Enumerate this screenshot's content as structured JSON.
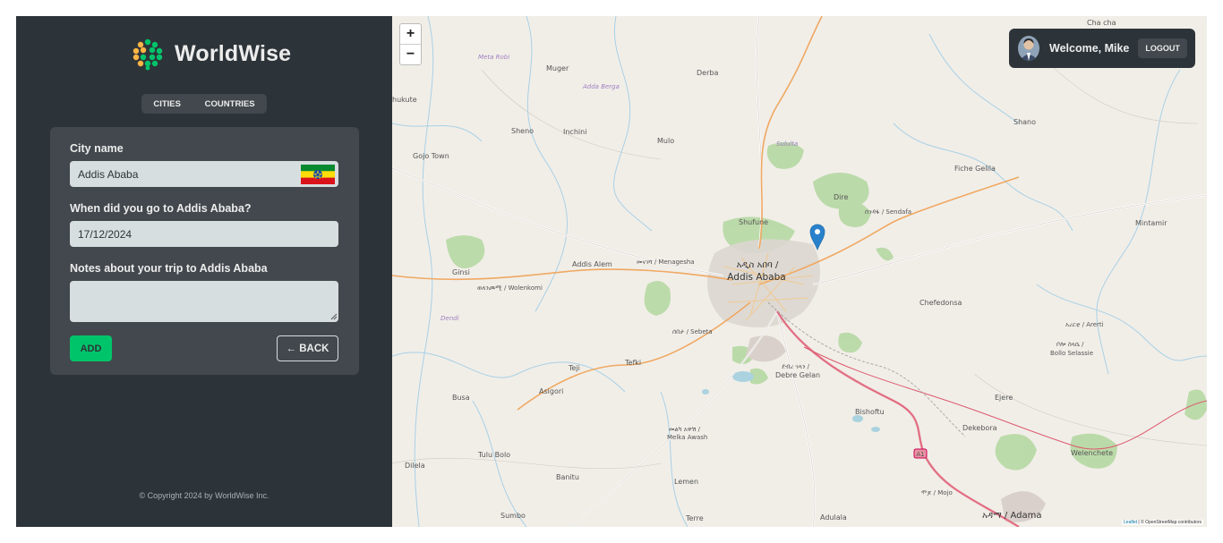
{
  "brand": {
    "name": "WorldWise"
  },
  "nav": {
    "cities": "CITIES",
    "countries": "COUNTRIES"
  },
  "form": {
    "city_label": "City name",
    "city_value": "Addis Ababa",
    "date_label": "When did you go to Addis Ababa?",
    "date_value": "17/12/2024",
    "notes_label": "Notes about your trip to Addis Ababa",
    "notes_value": "",
    "add_label": "ADD",
    "back_label": "← BACK"
  },
  "footer": {
    "copyright": "© Copyright 2024 by WorldWise Inc."
  },
  "user": {
    "welcome": "Welcome, Mike",
    "logout": "LOGOUT"
  },
  "map": {
    "zoom_in": "+",
    "zoom_out": "−",
    "attribution_leaflet": "Leaflet",
    "attribution_rest": " | © OpenStreetMap contributors",
    "places": {
      "muger": "Muger",
      "derba": "Derba",
      "sheno": "Sheno",
      "inchini": "Inchini",
      "mulo": "Mulo",
      "gojo_town": "Gojo Town",
      "hukute": "hukute",
      "shano": "Shano",
      "fiche_gelila": "Fiche Gelila",
      "dire": "Dire",
      "sendafa": "ሰንዳፋ / Sendafa",
      "shufune": "Shufune",
      "mintamir": "Mintamir",
      "addis_alem": "Addis Alem",
      "menagesha": "መናገሻ / Menagesha",
      "addis_am": "አዲስ አበባ /",
      "addis_en": "Addis Ababa",
      "ginsi": "Ginsi",
      "wolenkomi": "ወለንጮሚ / Wolenkomi",
      "chefedonsa": "Chefedonsa",
      "sebeta": "ሰበታ / Sebeta",
      "arerti": "አረርቲ / Arerti",
      "bollo_am": "ቦሎ ስላሴ /",
      "bollo_en": "Bollo Selassie",
      "teji": "Teji",
      "tefki": "Tefki",
      "debre_am": "ደብረ ገላን /",
      "debre_en": "Debre Gelan",
      "busa": "Busa",
      "asigori": "Asigori",
      "ejere": "Ejere",
      "bishoftu": "Bishoftu",
      "dekebora": "Dekebora",
      "melka_am": "መልካ አዋሽ /",
      "melka_en": "Melka Awash",
      "tulu_bolo": "Tulu Bolo",
      "dilela": "Dilela",
      "welenchete": "Welenchete",
      "banitu": "Banitu",
      "lemen": "Lemen",
      "mojo": "ሞጆ / Mojo",
      "sumbo": "Sumbo",
      "terre": "Terre",
      "adulala": "Adulala",
      "adama": "አዳማ / Adama",
      "chacha": "Cha cha",
      "a1": "A1",
      "dendi": "Dendi",
      "meta_robi": "Meta Robi",
      "adda_berga": "Adda Berga",
      "sululta": "Sululta"
    }
  }
}
